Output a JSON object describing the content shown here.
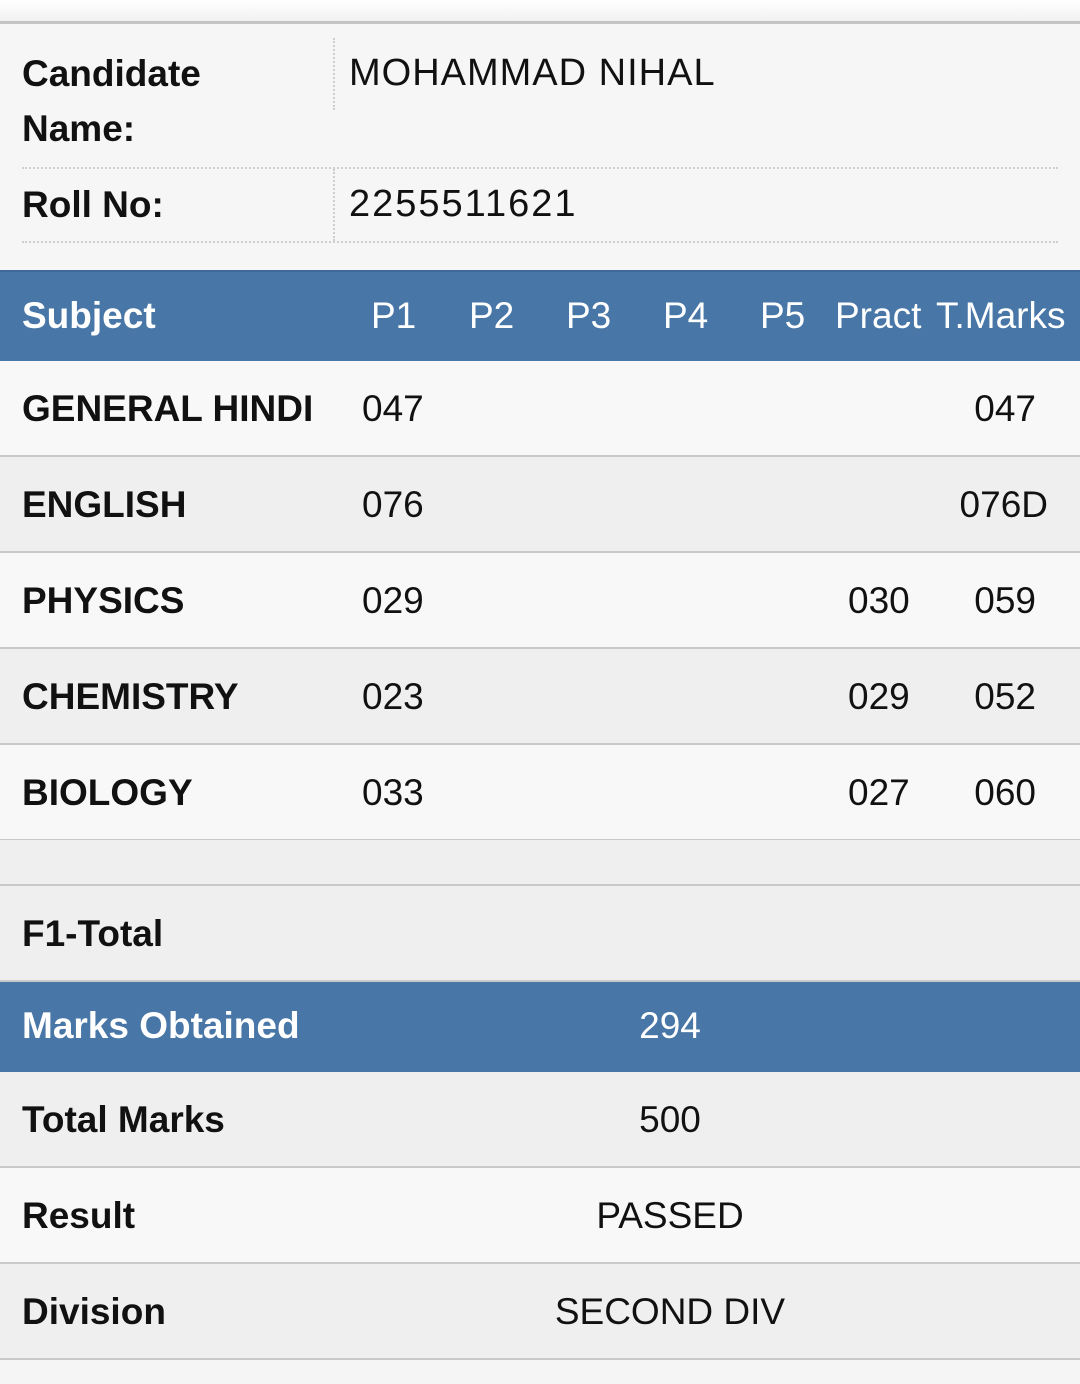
{
  "candidate": {
    "name_label": "Candidate Name:",
    "name_value": "MOHAMMAD NIHAL",
    "roll_label": "Roll No:",
    "roll_value": "2255511621"
  },
  "table": {
    "headers": {
      "subject": "Subject",
      "p1": "P1",
      "p2": "P2",
      "p3": "P3",
      "p4": "P4",
      "p5": "P5",
      "pract": "Pract",
      "total": "T.Marks"
    },
    "rows": [
      {
        "subject": "GENERAL HINDI",
        "p1": "047",
        "pract": "",
        "total": "047"
      },
      {
        "subject": "ENGLISH",
        "p1": "076",
        "pract": "",
        "total": "076D"
      },
      {
        "subject": "PHYSICS",
        "p1": "029",
        "pract": "030",
        "total": "059"
      },
      {
        "subject": "CHEMISTRY",
        "p1": "023",
        "pract": "029",
        "total": "052"
      },
      {
        "subject": "BIOLOGY",
        "p1": "033",
        "pract": "027",
        "total": "060"
      }
    ]
  },
  "summary": {
    "f1_total_label": "F1-Total",
    "marks_obtained_label": "Marks Obtained",
    "marks_obtained_value": "294",
    "total_marks_label": "Total Marks",
    "total_marks_value": "500",
    "result_label": "Result",
    "result_value": "PASSED",
    "division_label": "Division",
    "division_value": "SECOND DIV"
  },
  "colors": {
    "header_blue": "#4776a7",
    "header_text": "#ffffff",
    "row_light": "#f8f8f8",
    "row_dark": "#efefef"
  }
}
